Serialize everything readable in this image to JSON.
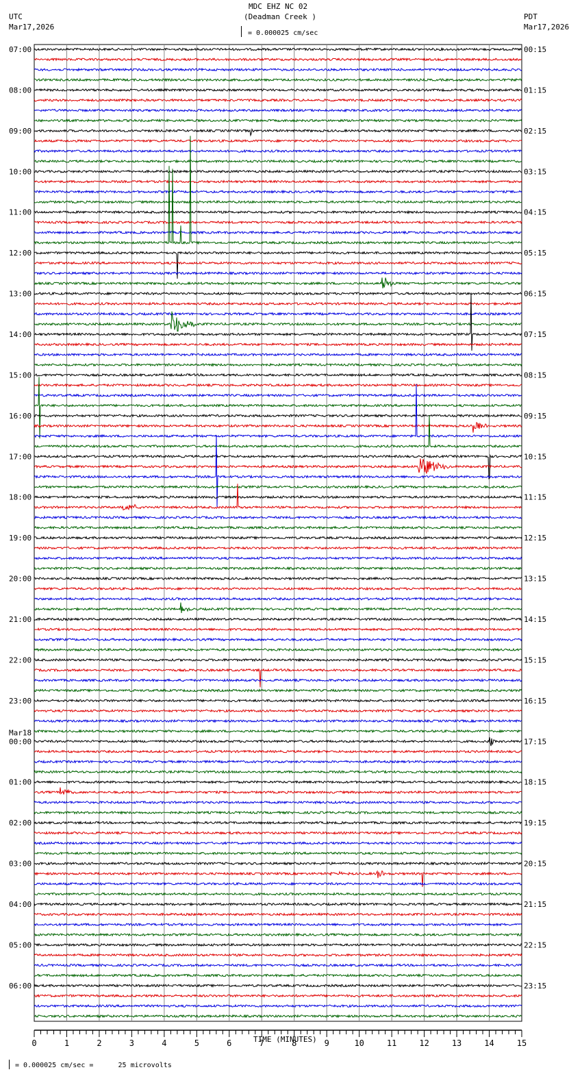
{
  "header": {
    "title": "MDC EHZ NC 02",
    "subtitle": "(Deadman Creek )",
    "left_tz": "UTC",
    "left_date": "Mar17,2026",
    "right_tz": "PDT",
    "right_date": "Mar17,2026",
    "scale_text": "= 0.000025 cm/sec"
  },
  "footer": {
    "scale_text": "= 0.000025 cm/sec =      25 microvolts"
  },
  "chart_data": {
    "type": "line",
    "title": "MDC EHZ NC 02 (Deadman Creek )",
    "xlabel": "TIME (MINUTES)",
    "xlim": [
      0,
      15
    ],
    "x_ticks": [
      "0",
      "1",
      "2",
      "3",
      "4",
      "5",
      "6",
      "7",
      "8",
      "9",
      "10",
      "11",
      "12",
      "13",
      "14",
      "15"
    ],
    "traces_per_hour": 4,
    "trace_colors": [
      "#000000",
      "#e00000",
      "#0000e0",
      "#006400"
    ],
    "left_labels": [
      "07:00",
      "08:00",
      "09:00",
      "10:00",
      "11:00",
      "12:00",
      "13:00",
      "14:00",
      "15:00",
      "16:00",
      "17:00",
      "18:00",
      "19:00",
      "20:00",
      "21:00",
      "22:00",
      "23:00",
      "00:00",
      "01:00",
      "02:00",
      "03:00",
      "04:00",
      "05:00",
      "06:00"
    ],
    "left_date_change": {
      "before_label": "00:00",
      "text": "Mar18"
    },
    "right_labels": [
      "00:15",
      "01:15",
      "02:15",
      "03:15",
      "04:15",
      "05:15",
      "06:15",
      "07:15",
      "08:15",
      "09:15",
      "10:15",
      "11:15",
      "12:15",
      "13:15",
      "14:15",
      "15:15",
      "16:15",
      "17:15",
      "18:15",
      "19:15",
      "20:15",
      "21:15",
      "22:15",
      "23:15"
    ],
    "events": [
      {
        "trace": 8,
        "minute": 6.65,
        "kind": "burst",
        "amp": 0.5,
        "dur": 0.15
      },
      {
        "trace": 19,
        "minute": 4.15,
        "kind": "spike",
        "amp": -7.5
      },
      {
        "trace": 19,
        "minute": 4.25,
        "kind": "spike",
        "amp": -7.2
      },
      {
        "trace": 19,
        "minute": 4.8,
        "kind": "spike",
        "amp": -10.5
      },
      {
        "trace": 19,
        "minute": 4.5,
        "kind": "spike",
        "amp": -1.6
      },
      {
        "trace": 20,
        "minute": 4.4,
        "kind": "spike",
        "amp": 2.5
      },
      {
        "trace": 23,
        "minute": 10.7,
        "kind": "burst",
        "amp": 1.0,
        "dur": 0.4
      },
      {
        "trace": 27,
        "minute": 4.2,
        "kind": "burst",
        "amp": 1.4,
        "dur": 0.8
      },
      {
        "trace": 28,
        "minute": 13.45,
        "kind": "spike",
        "amp": -4.0
      },
      {
        "trace": 28,
        "minute": 13.47,
        "kind": "spike",
        "amp": 1.7
      },
      {
        "trace": 35,
        "minute": 0.15,
        "kind": "spike",
        "amp": -2.8
      },
      {
        "trace": 35,
        "minute": 0.17,
        "kind": "spike",
        "amp": 3.2
      },
      {
        "trace": 37,
        "minute": 13.5,
        "kind": "burst",
        "amp": 0.6,
        "dur": 0.6
      },
      {
        "trace": 38,
        "minute": 11.75,
        "kind": "spike",
        "amp": -5.0
      },
      {
        "trace": 39,
        "minute": 12.15,
        "kind": "spike",
        "amp": -3.0
      },
      {
        "trace": 40,
        "minute": 14.0,
        "kind": "spike",
        "amp": 2.2
      },
      {
        "trace": 41,
        "minute": 11.8,
        "kind": "burst",
        "amp": 1.2,
        "dur": 1.0
      },
      {
        "trace": 42,
        "minute": 5.6,
        "kind": "spike",
        "amp": -4.0
      },
      {
        "trace": 42,
        "minute": 5.62,
        "kind": "spike",
        "amp": 3.0
      },
      {
        "trace": 45,
        "minute": 2.7,
        "kind": "burst",
        "amp": 0.5,
        "dur": 0.8
      },
      {
        "trace": 45,
        "minute": 6.25,
        "kind": "spike",
        "amp": -2.3
      },
      {
        "trace": 55,
        "minute": 4.5,
        "kind": "burst",
        "amp": 0.6,
        "dur": 0.3
      },
      {
        "trace": 61,
        "minute": 6.95,
        "kind": "spike",
        "amp": 1.6
      },
      {
        "trace": 68,
        "minute": 14.0,
        "kind": "burst",
        "amp": 0.8,
        "dur": 0.15
      },
      {
        "trace": 73,
        "minute": 0.8,
        "kind": "burst",
        "amp": 0.7,
        "dur": 0.5
      },
      {
        "trace": 81,
        "minute": 9.1,
        "kind": "burst",
        "amp": 0.3,
        "dur": 0.6
      },
      {
        "trace": 81,
        "minute": 10.55,
        "kind": "burst",
        "amp": 0.7,
        "dur": 0.3
      },
      {
        "trace": 81,
        "minute": 11.95,
        "kind": "spike",
        "amp": 1.2
      }
    ]
  }
}
